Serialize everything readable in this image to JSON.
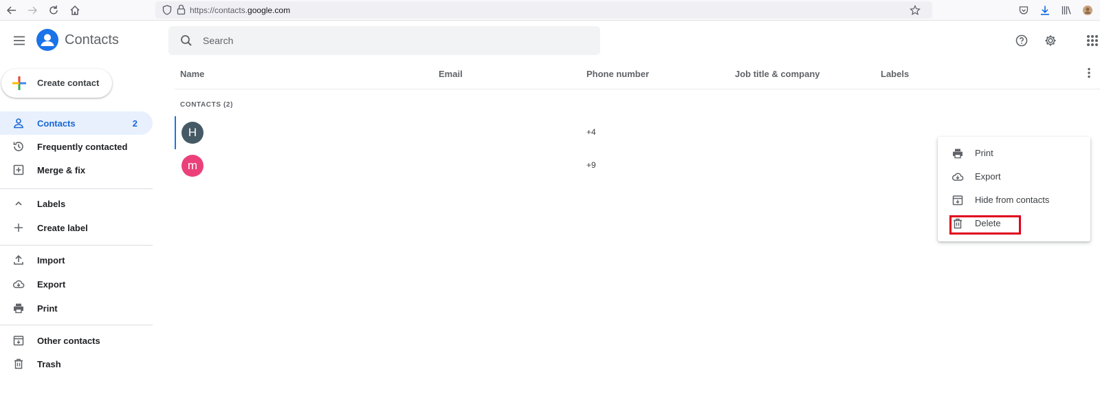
{
  "browser": {
    "url_prefix": "https://contacts.",
    "url_host": "google.com"
  },
  "header": {
    "app_title": "Contacts",
    "search_placeholder": "Search"
  },
  "sidebar": {
    "create_label": "Create contact",
    "items": [
      {
        "label": "Contacts",
        "count": "2",
        "icon": "person-icon",
        "active": true
      },
      {
        "label": "Frequently contacted",
        "icon": "history-icon"
      },
      {
        "label": "Merge & fix",
        "icon": "merge-icon"
      },
      {
        "label": "Labels",
        "icon": "chevron-up-icon"
      },
      {
        "label": "Create label",
        "icon": "plus-icon"
      },
      {
        "label": "Import",
        "icon": "upload-icon"
      },
      {
        "label": "Export",
        "icon": "cloud-download-icon"
      },
      {
        "label": "Print",
        "icon": "print-icon"
      },
      {
        "label": "Other contacts",
        "icon": "archive-icon"
      },
      {
        "label": "Trash",
        "icon": "trash-icon"
      }
    ]
  },
  "table": {
    "columns": [
      "Name",
      "Email",
      "Phone number",
      "Job title & company",
      "Labels"
    ],
    "section_label": "CONTACTS (2)",
    "rows": [
      {
        "initial": "H",
        "avatar_color": "#455a64",
        "phone": "+4"
      },
      {
        "initial": "m",
        "avatar_color": "#ec407a",
        "phone": "+9"
      }
    ]
  },
  "menu": {
    "items": [
      {
        "label": "Print",
        "icon": "print-icon"
      },
      {
        "label": "Export",
        "icon": "cloud-download-icon"
      },
      {
        "label": "Hide from contacts",
        "icon": "archive-icon"
      },
      {
        "label": "Delete",
        "icon": "trash-icon",
        "highlighted": true
      }
    ]
  },
  "colors": {
    "accent": "#1a73e8",
    "active_bg": "#e8f0fe",
    "highlight_box": "#e0001b"
  }
}
